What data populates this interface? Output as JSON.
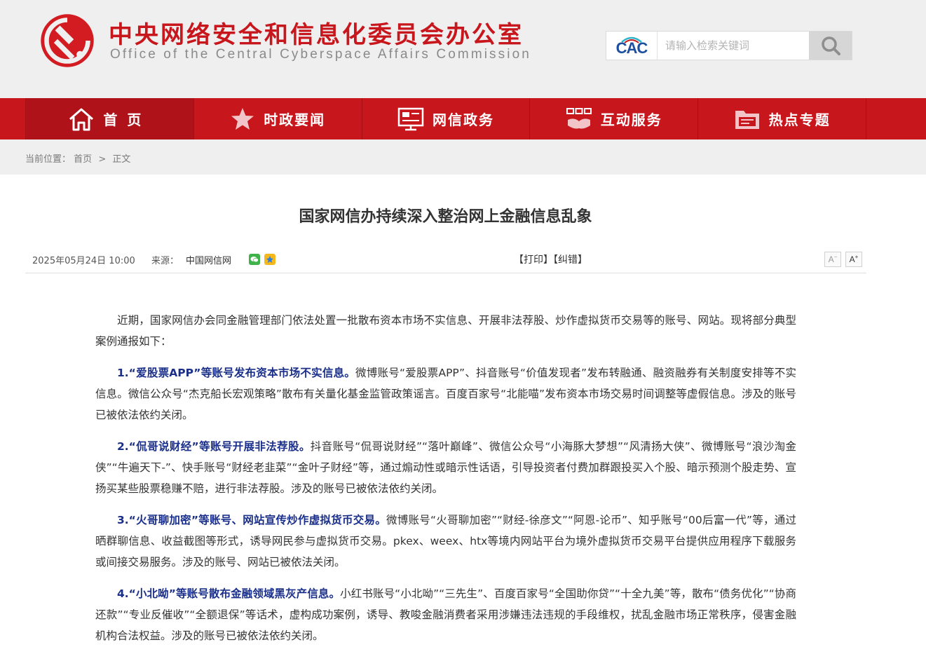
{
  "header": {
    "title_cn": "中央网络安全和信息化委员会办公室",
    "title_en": "Office of the Central Cyberspace Affairs Commission",
    "search_logo": "CAC",
    "search_placeholder": "请输入检索关键词"
  },
  "nav": {
    "items": [
      {
        "label": "首页",
        "icon": "home-icon"
      },
      {
        "label": "时政要闻",
        "icon": "star-icon"
      },
      {
        "label": "网信政务",
        "icon": "screen-icon"
      },
      {
        "label": "互动服务",
        "icon": "handshake-icon"
      },
      {
        "label": "热点专题",
        "icon": "folder-icon"
      }
    ]
  },
  "breadcrumb": {
    "prefix": "当前位置：",
    "home": "首页",
    "separator": ">",
    "current": "正文"
  },
  "article": {
    "title": "国家网信办持续深入整治网上金融信息乱象",
    "date": "2025年05月24日  10:00",
    "source_label": "来源：",
    "source": "中国网信网",
    "print": "【打印】",
    "correct": "【纠错】",
    "font_small": "A",
    "font_large": "A",
    "intro": "近期，国家网信办会同金融管理部门依法处置一批散布资本市场不实信息、开展非法荐股、炒作虚拟货币交易等的账号、网站。现将部分典型案例通报如下：",
    "cases": [
      {
        "head": "1.“爱股票APP”等账号发布资本市场不实信息。",
        "body": "微博账号“爱股票APP”、抖音账号“价值发现者”发布转融通、融资融券有关制度安排等不实信息。微信公众号“杰克船长宏观策略”散布有关量化基金监管政策谣言。百度百家号“北能喵”发布资本市场交易时间调整等虚假信息。涉及的账号已被依法依约关闭。"
      },
      {
        "head": "2.“侃哥说财经”等账号开展非法荐股。",
        "body": "抖音账号“侃哥说财经”“落叶巅峰”、微信公众号“小海豚大梦想”“风清扬大侠”、微博账号“浪沙淘金侠”“牛遍天下-”、快手账号“财经老韭菜”“金叶子财经”等，通过煽动性或暗示性话语，引导投资者付费加群跟投买入个股、暗示预测个股走势、宣扬买某些股票稳赚不赔，进行非法荐股。涉及的账号已被依法依约关闭。"
      },
      {
        "head": "3.“火哥聊加密”等账号、网站宣传炒作虚拟货币交易。",
        "body": "微博账号“火哥聊加密”“财经-徐彦文”“阿恩-论币”、知乎账号“00后富一代”等，通过晒群聊信息、收益截图等形式，诱导网民参与虚拟货币交易。pkex、weex、htx等境内网站平台为境外虚拟货币交易平台提供应用程序下载服务或间接交易服务。涉及的账号、网站已被依法关闭。"
      },
      {
        "head": "4.“小北呦”等账号散布金融领域黑灰产信息。",
        "body": "小红书账号“小北呦”“三先生”、百度百家号“全国助你贷”“十全九美”等，散布“债务优化”“协商还款”“专业反催收”“全额退保”等话术，虚构成功案例，诱导、教唆金融消费者采用涉嫌违法违规的手段维权，扰乱金融市场正常秩序，侵害金融机构合法权益。涉及的账号已被依法依约关闭。"
      }
    ]
  },
  "colors": {
    "brand_red": "#c8161d",
    "case_heading_blue": "#1a2f8a",
    "header_bg": "#efefef"
  }
}
